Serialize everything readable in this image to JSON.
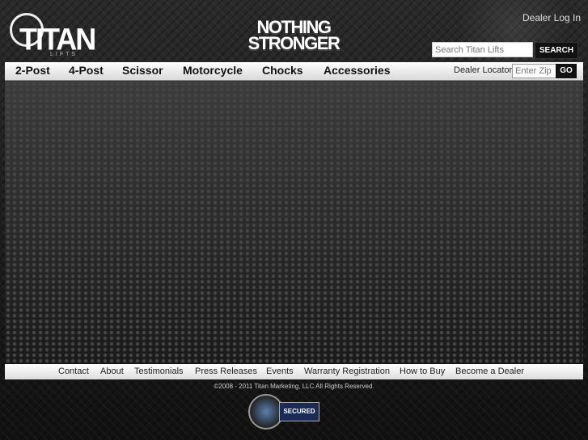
{
  "header": {
    "logo_text": "TITAN",
    "logo_subtext": "LIFTS",
    "tagline_line1": "NOTHING",
    "tagline_line2": "STRONGER",
    "dealer_login": "Dealer Log In",
    "search": {
      "placeholder": "Search Titan Lifts",
      "button_label": "SEARCH"
    }
  },
  "nav": {
    "items": [
      "2-Post",
      "4-Post",
      "Scissor",
      "Motorcycle",
      "Chocks",
      "Accessories"
    ],
    "dealer_locator_label": "Dealer Locator",
    "zip_placeholder": "Enter Zip",
    "go_label": "GO"
  },
  "footer": {
    "links": [
      "Contact",
      "About",
      "Testimonials",
      "Press Releases",
      "Events",
      "Warranty Registration",
      "How to Buy",
      "Become a Dealer"
    ],
    "copyright": "©2008 - 2011 Titan Marketing, LLC All Rights Reserved.",
    "seal_text": "SECURED"
  },
  "colors": {
    "nav_bg": "#ffffff",
    "button_bg": "#111111",
    "page_bg": "#1a1a1a"
  }
}
